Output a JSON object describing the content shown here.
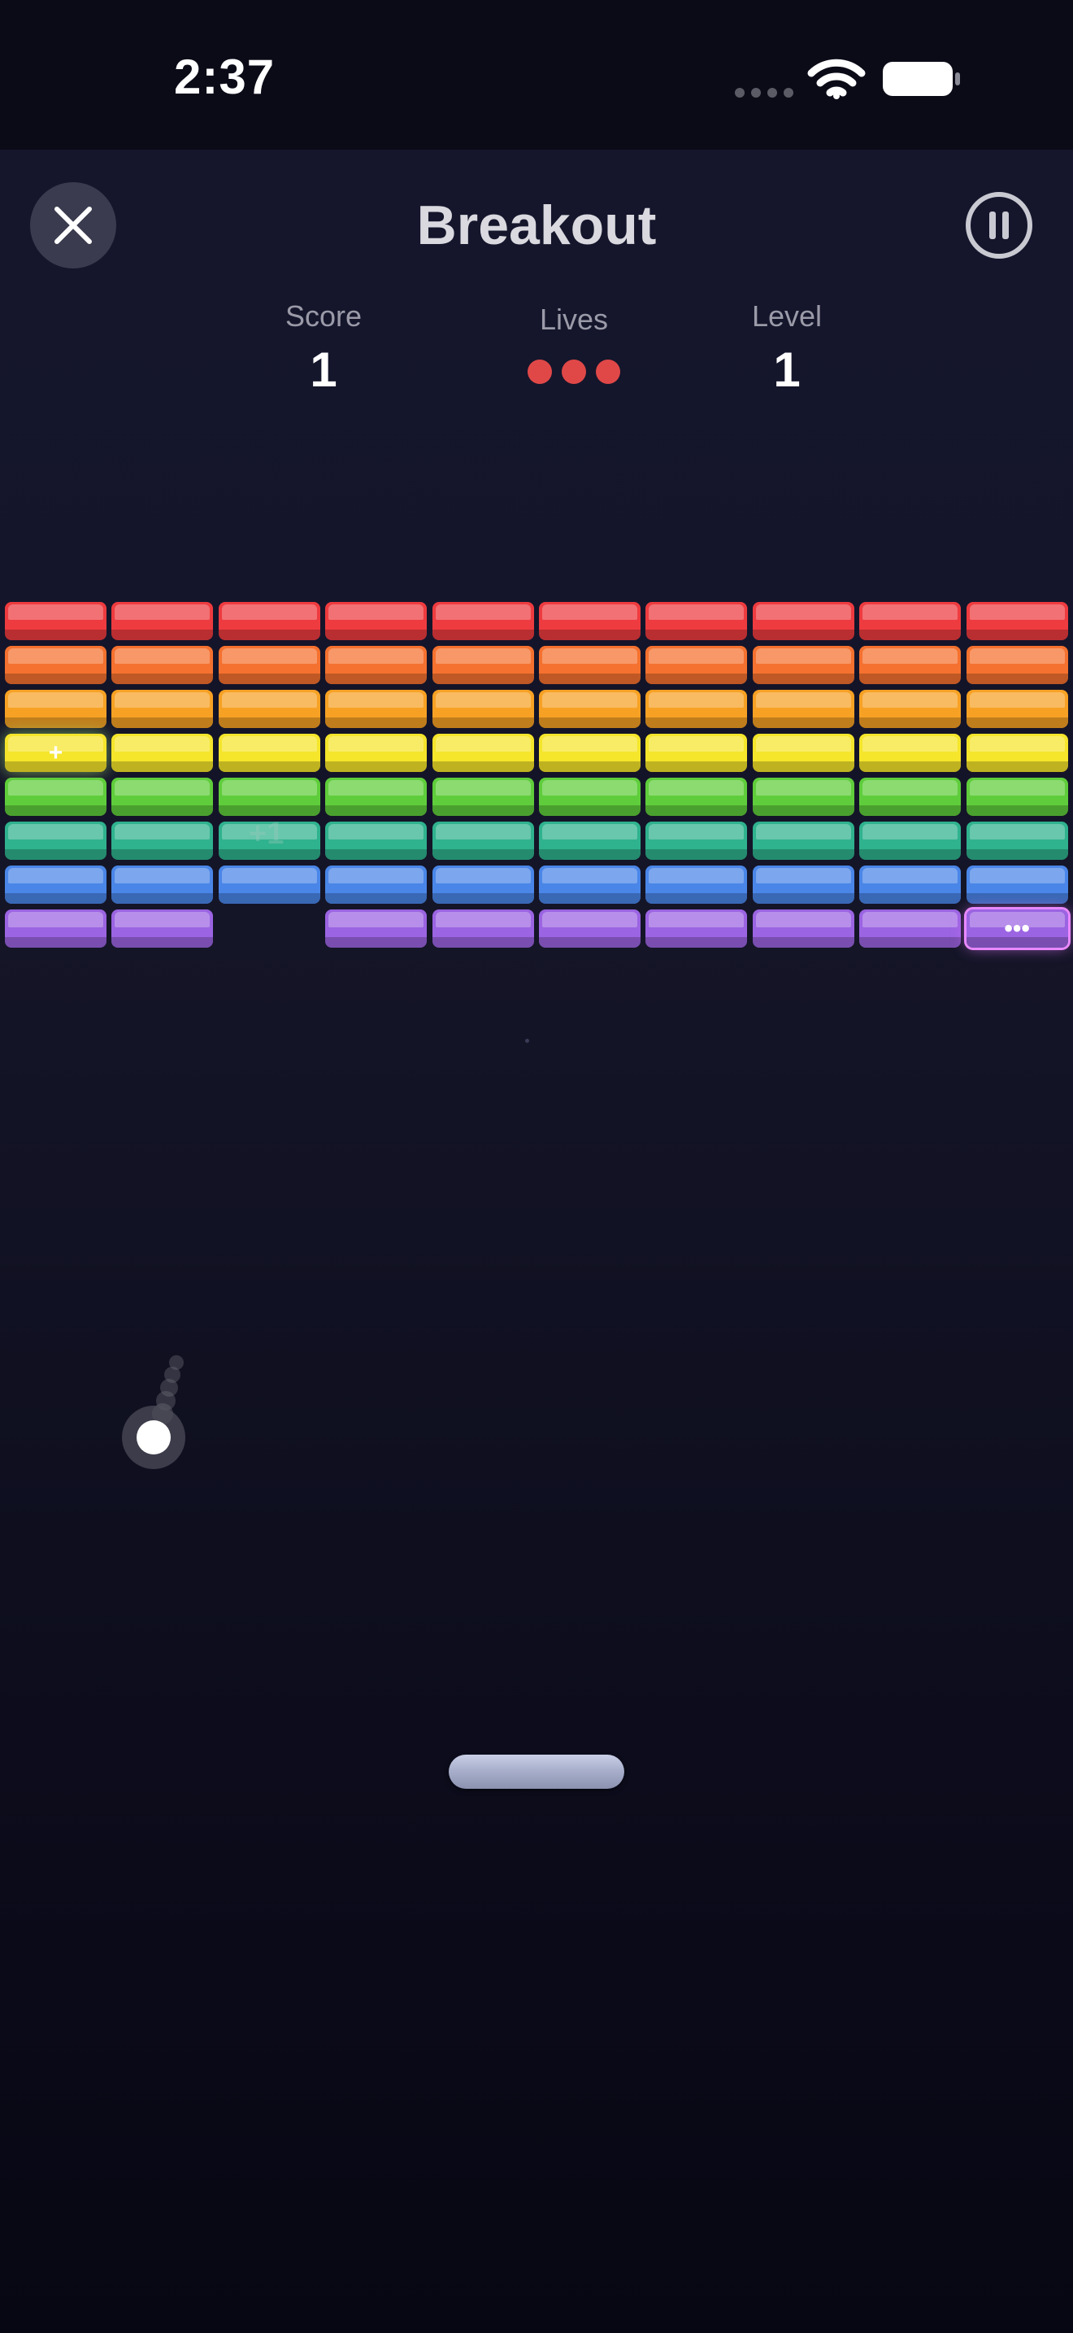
{
  "status_bar": {
    "time": "2:37",
    "icons": [
      "signal-dots-icon",
      "wifi-icon",
      "battery-icon"
    ]
  },
  "header": {
    "title": "Breakout",
    "close_icon": "close-icon",
    "pause_icon": "pause-icon"
  },
  "stats": {
    "score_label": "Score",
    "score_value": "1",
    "lives_label": "Lives",
    "lives_count": 3,
    "level_label": "Level",
    "level_value": "1"
  },
  "colors": {
    "life": "#e04848",
    "rows": [
      "#ee3b3f",
      "#f5712f",
      "#f7a124",
      "#f5e52b",
      "#5fcd3b",
      "#2fb28e",
      "#4a86e8",
      "#9b64e2"
    ]
  },
  "bricks": {
    "columns": 10,
    "rows": 8,
    "removed": [
      [
        7,
        2
      ]
    ],
    "specials": [
      {
        "row": 3,
        "col": 0,
        "symbol": "+"
      },
      {
        "row": 7,
        "col": 9,
        "symbol": "•••"
      }
    ]
  },
  "floating_text": "+1",
  "ball_icon": "ball-icon",
  "paddle_icon": "paddle-icon"
}
